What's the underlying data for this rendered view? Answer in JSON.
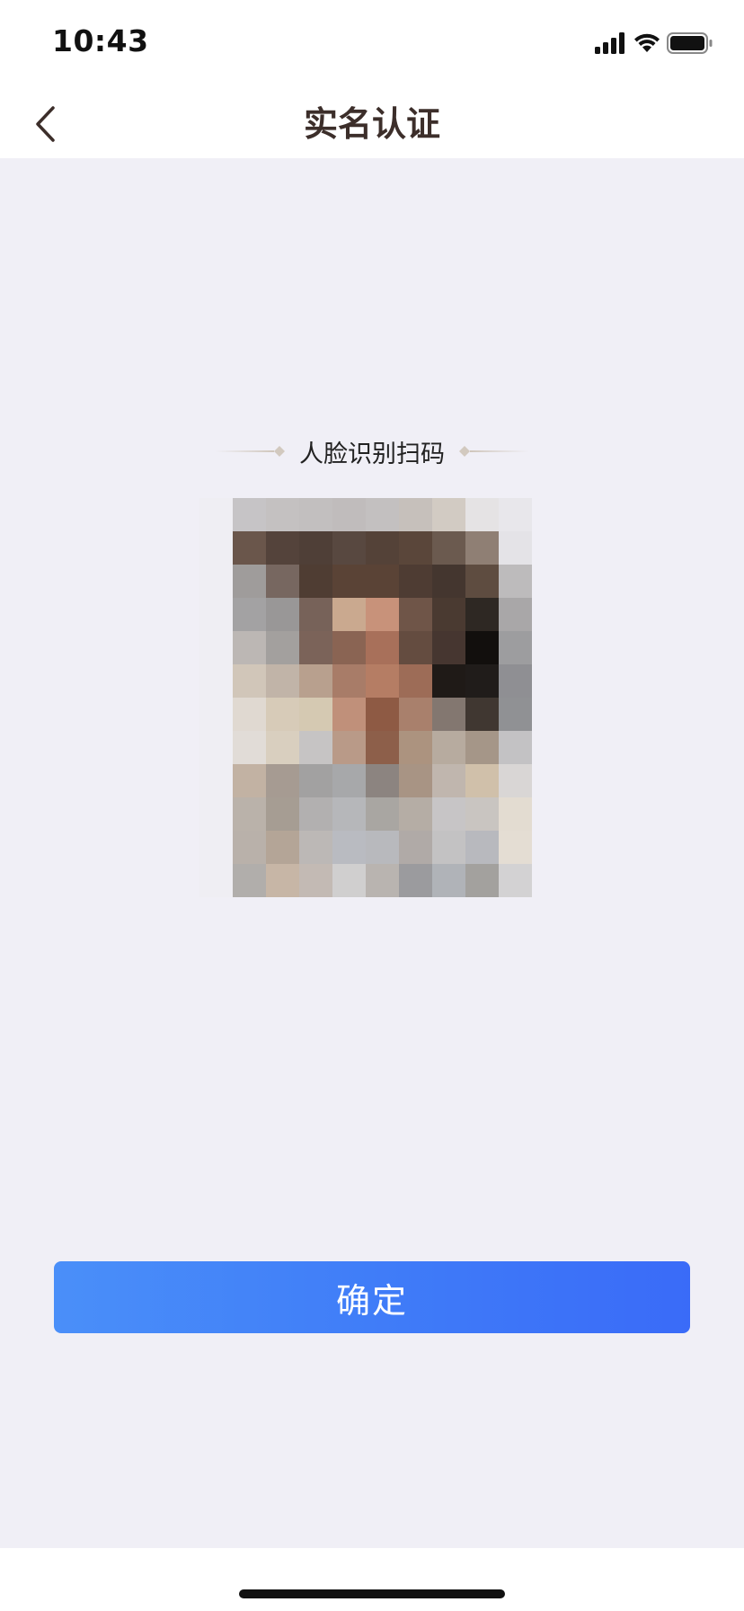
{
  "status_bar": {
    "time": "10:43",
    "icons": [
      "cellular-signal-icon",
      "wifi-icon",
      "battery-icon"
    ]
  },
  "nav": {
    "back_icon": "chevron-left-icon",
    "title": "实名认证"
  },
  "scan": {
    "heading": "人脸识别扫码",
    "image": "blurred-face-photo"
  },
  "actions": {
    "confirm_label": "确定"
  },
  "colors": {
    "accent": "#3f7bf8",
    "background": "#f0eff6",
    "title": "#3c2e2a"
  }
}
